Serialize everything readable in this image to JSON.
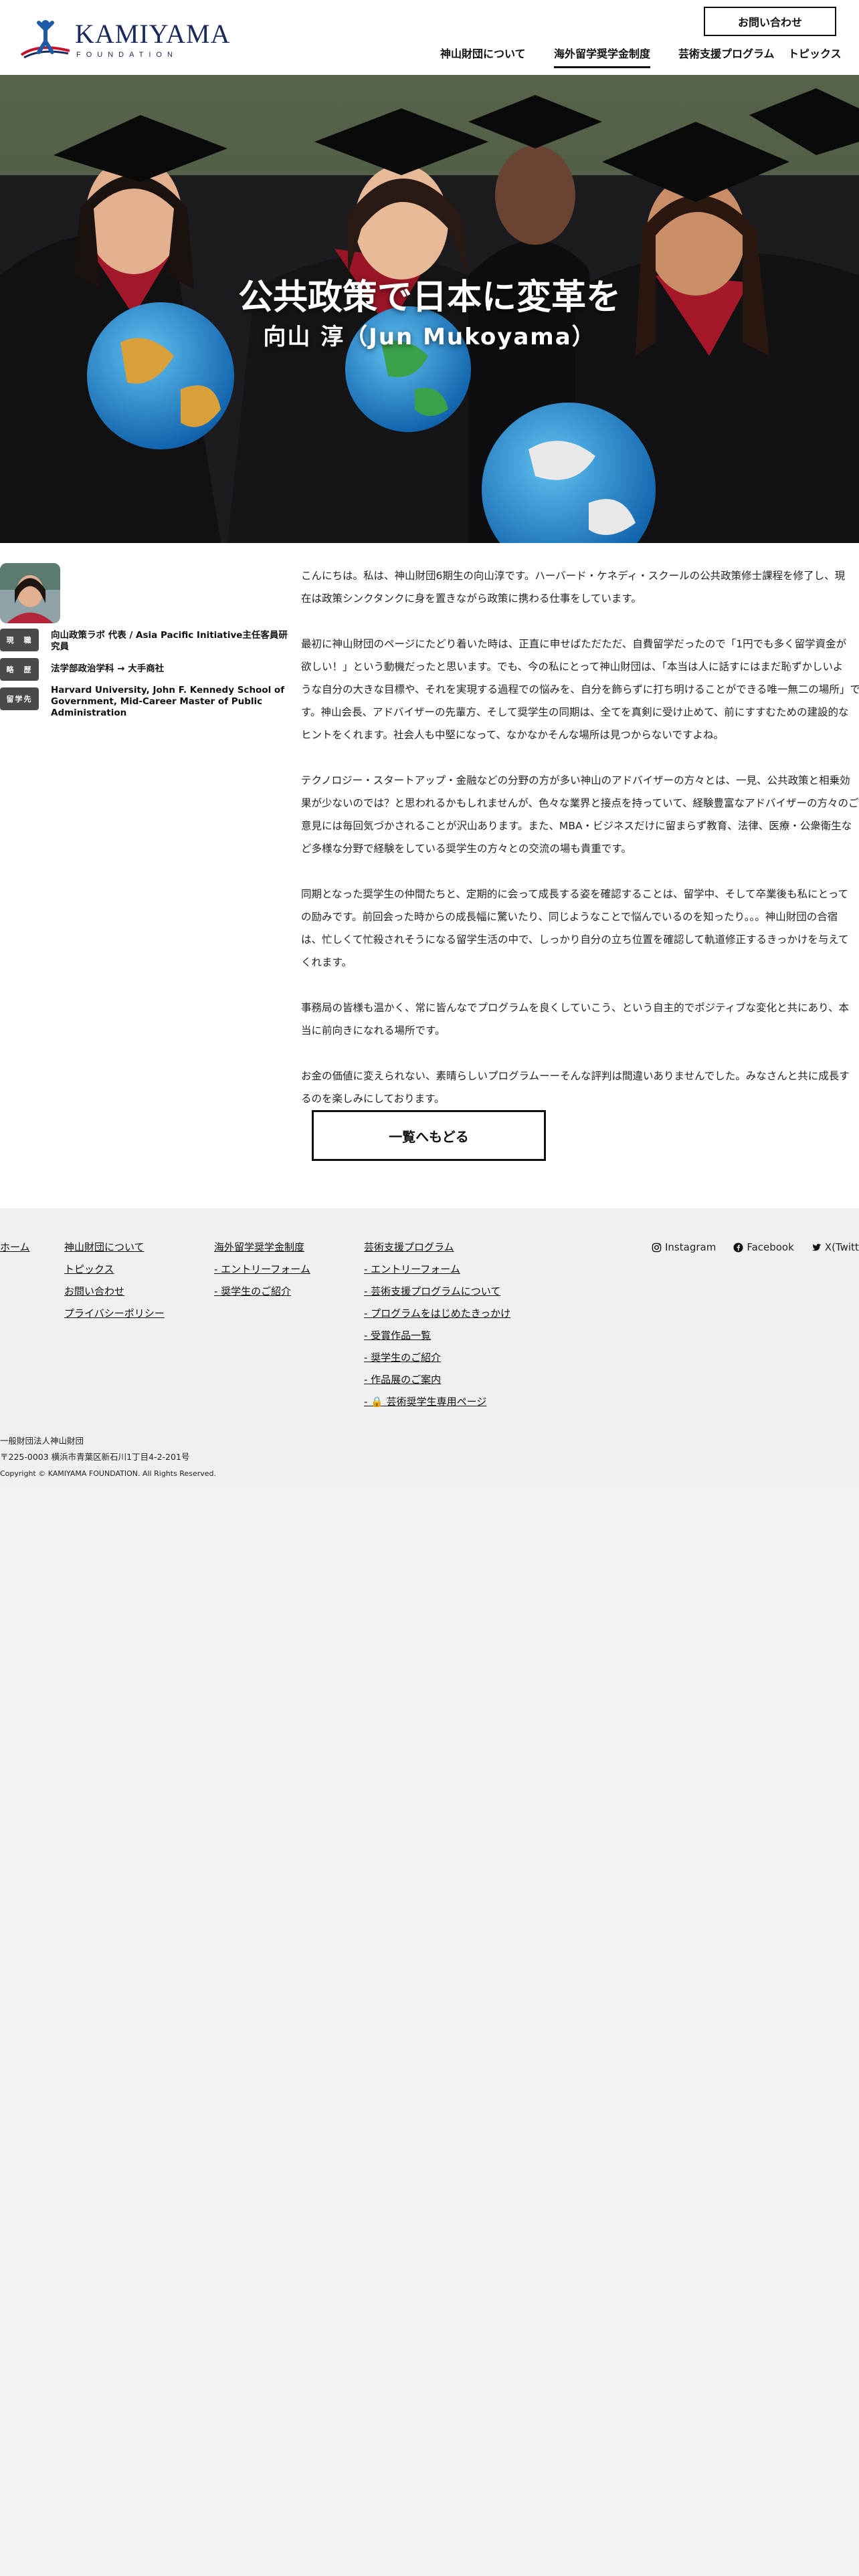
{
  "header": {
    "logo_name": "KAMIYAMA",
    "logo_sub": "FOUNDATION",
    "contact_label": "お問い合わせ",
    "nav": [
      {
        "label": "神山財団について"
      },
      {
        "label": "海外留学奨学金制度"
      },
      {
        "label": "芸術支援プログラム"
      },
      {
        "label": "トピックス"
      }
    ],
    "active_nav": "海外留学奨学金制度"
  },
  "hero": {
    "title": "公共政策で日本に変革を",
    "subtitle": "向山 淳（Jun Mukoyama）"
  },
  "profile": {
    "rows": [
      {
        "label": "現　職",
        "value": "向山政策ラボ 代表 / Asia Pacific Initiative主任客員研究員"
      },
      {
        "label": "略　歴",
        "value": "法学部政治学科 → 大手商社"
      },
      {
        "label": "留学先",
        "value": "Harvard University, John F. Kennedy School of Government, Mid-Career Master of Public Administration"
      }
    ]
  },
  "article": {
    "paragraphs": [
      [
        "こんにちは。私は、神山財団6期生の向山淳です。ハーバード・ケネディ・スクールの公共政策修士課程を修了し、現",
        "在は政策シンクタンクに身を置きながら政策に携わる仕事をしています。"
      ],
      [
        "最初に神山財団のページにたどり着いた時は、正直に申せばただただ、自費留学だったので「1円でも多く留学資金が",
        "欲しい！」という動機だったと思います。でも、今の私にとって神山財団は、「本当は人に話すにはまだ恥ずかしいよ",
        "うな自分の大きな目標や、それを実現する過程での悩みを、自分を飾らずに打ち明けることができる唯一無二の場所」で",
        "す。神山会長、アドバイザーの先輩方、そして奨学生の同期は、全てを真剣に受け止めて、前にすすむための建設的な",
        "ヒントをくれます。社会人も中堅になって、なかなかそんな場所は見つからないですよね。"
      ],
      [
        "テクノロジー・スタートアップ・金融などの分野の方が多い神山のアドバイザーの方々とは、一見、公共政策と相乗効",
        "果が少ないのでは？と思われるかもしれませんが、色々な業界と接点を持っていて、経験豊富なアドバイザーの方々のご",
        "意見には毎回気づかされることが沢山あります。また、MBA・ビジネスだけに留まらず教育、法律、医療・公衆衛生な",
        "ど多様な分野で経験をしている奨学生の方々との交流の場も貴重です。"
      ],
      [
        "同期となった奨学生の仲間たちと、定期的に会って成長する姿を確認することは、留学中、そして卒業後も私にとって",
        "の励みです。前回会った時からの成長幅に驚いたり、同じようなことで悩んでいるのを知ったり。。。神山財団の合宿",
        "は、忙しくて忙殺されそうになる留学生活の中で、しっかり自分の立ち位置を確認して軌道修正するきっかけを与えて",
        "くれます。"
      ],
      [
        "事務局の皆様も温かく、常に皆んなでプログラムを良くしていこう、という自主的でポジティブな変化と共にあり、本",
        "当に前向きになれる場所です。"
      ],
      [
        "お金の価値に変えられない、素晴らしいプログラムーーそんな評判は間違いありませんでした。みなさんと共に成長す",
        "るのを楽しみにしております。"
      ]
    ]
  },
  "back_label": "一覧へもどる",
  "footer": {
    "col1": [
      "ホーム"
    ],
    "col2": [
      "神山財団について",
      "トピックス",
      "お問い合わせ",
      "プライバシーポリシー"
    ],
    "col3": [
      "海外留学奨学金制度",
      "- エントリーフォーム",
      "- 奨学生のご紹介"
    ],
    "col4": [
      "芸術支援プログラム",
      "- エントリーフォーム",
      "- 芸術支援プログラムについて",
      "- プログラムをはじめたきっかけ",
      "- 受賞作品一覧",
      "- 奨学生のご紹介",
      "- 作品展のご案内",
      "- 🔒 芸術奨学生専用ページ"
    ],
    "social": [
      "Instagram",
      "Facebook",
      "X(Twitter)"
    ],
    "org_name": "一般財団法人神山財団",
    "address": "〒225-0003 横浜市青葉区新石川1丁目4-2-201号",
    "copyright": "Copyright © KAMIYAMA FOUNDATION. All Rights Reserved."
  }
}
